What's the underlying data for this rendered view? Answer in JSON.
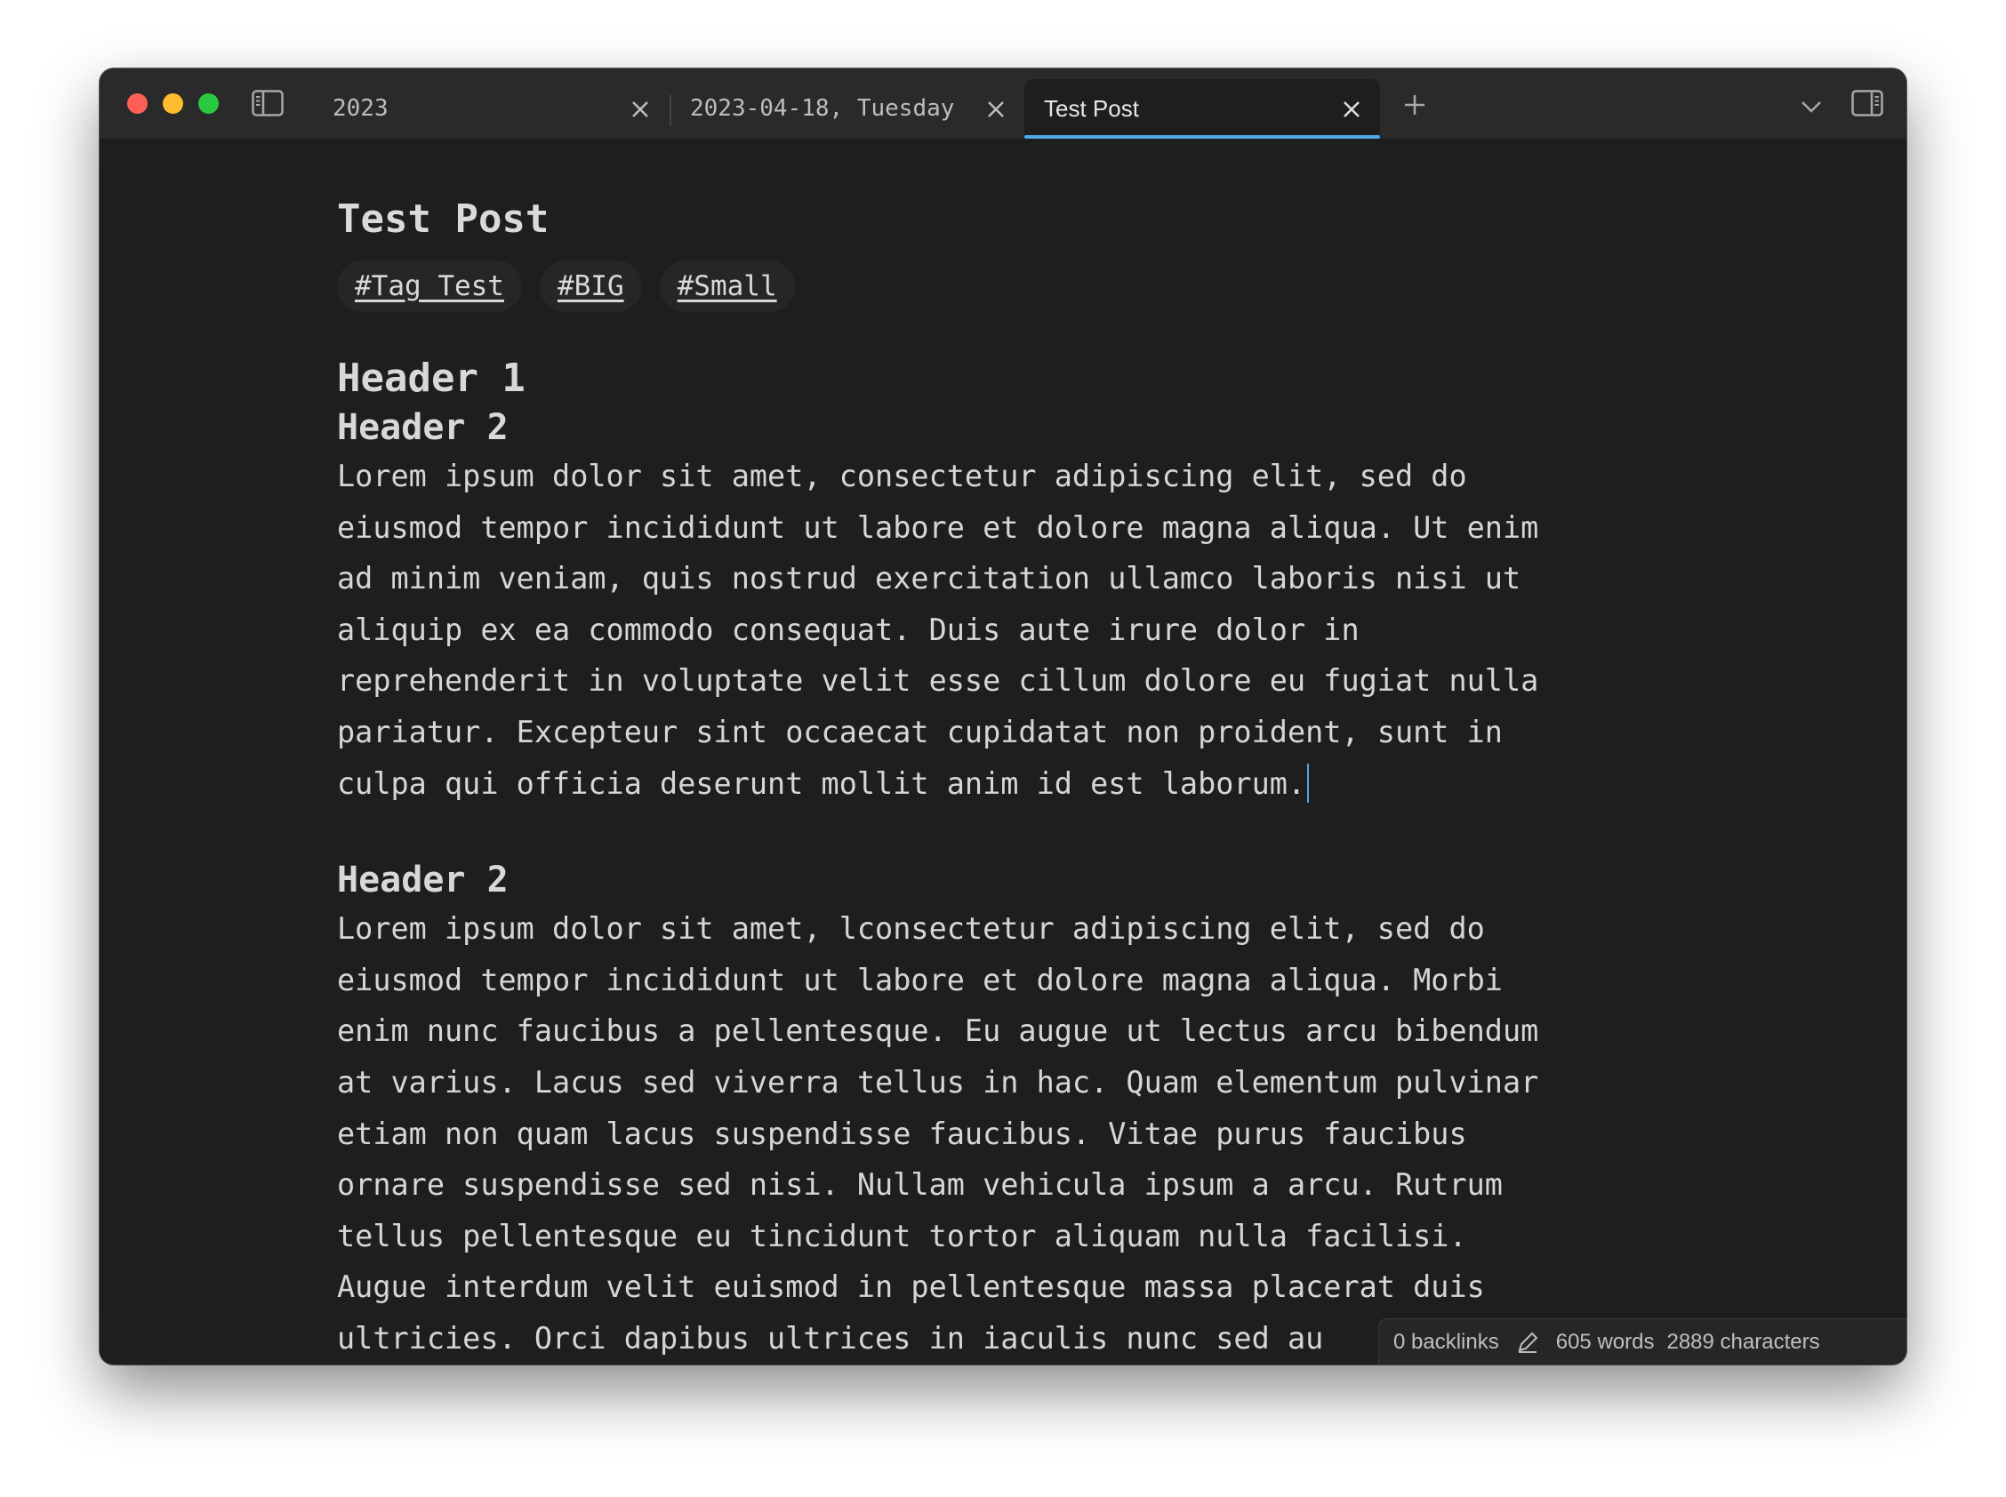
{
  "tabs": [
    {
      "label": "2023"
    },
    {
      "label": "2023-04-18, Tuesday"
    },
    {
      "label": "Test Post"
    }
  ],
  "document": {
    "title": "Test Post",
    "tags": [
      "#Tag_Test",
      "#BIG",
      "#Small"
    ],
    "header1": "Header 1",
    "section1": {
      "header": "Header 2",
      "lines": [
        "Lorem ipsum dolor sit amet, consectetur adipiscing elit, sed do",
        "eiusmod tempor incididunt ut labore et dolore magna aliqua. Ut enim",
        "ad minim veniam, quis nostrud exercitation ullamco laboris nisi ut",
        "aliquip ex ea commodo consequat. Duis aute irure dolor in",
        "reprehenderit in voluptate velit esse cillum dolore eu fugiat nulla",
        "pariatur. Excepteur sint occaecat cupidatat non proident, sunt in",
        "culpa qui officia deserunt mollit anim id est laborum."
      ]
    },
    "section2": {
      "header": "Header 2",
      "lines": [
        "Lorem ipsum dolor sit amet, lconsectetur adipiscing elit, sed do",
        "eiusmod tempor incididunt ut labore et dolore magna aliqua. Morbi",
        "enim nunc faucibus a pellentesque. Eu augue ut lectus arcu bibendum",
        "at varius. Lacus sed viverra tellus in hac. Quam elementum pulvinar",
        "etiam non quam lacus suspendisse faucibus. Vitae purus faucibus",
        "ornare suspendisse sed nisi. Nullam vehicula ipsum a arcu. Rutrum",
        "tellus pellentesque eu tincidunt tortor aliquam nulla facilisi.",
        "Augue interdum velit euismod in pellentesque massa placerat duis",
        "ultricies. Orci dapibus ultrices in iaculis nunc sed au"
      ]
    }
  },
  "status": {
    "backlinks": "0 backlinks",
    "words": "605 words",
    "characters": "2889 characters"
  },
  "icons": {
    "sidebar_left": "sidebar-left-icon",
    "tab_close": "close-icon",
    "new_tab": "plus-icon",
    "tab_list": "chevron-down-icon",
    "sidebar_right": "sidebar-right-icon",
    "edit_mode": "pencil-icon"
  },
  "colors": {
    "accent": "#4fa8e8",
    "background": "#1e1e1e",
    "titlebar": "#2a2a2a"
  }
}
